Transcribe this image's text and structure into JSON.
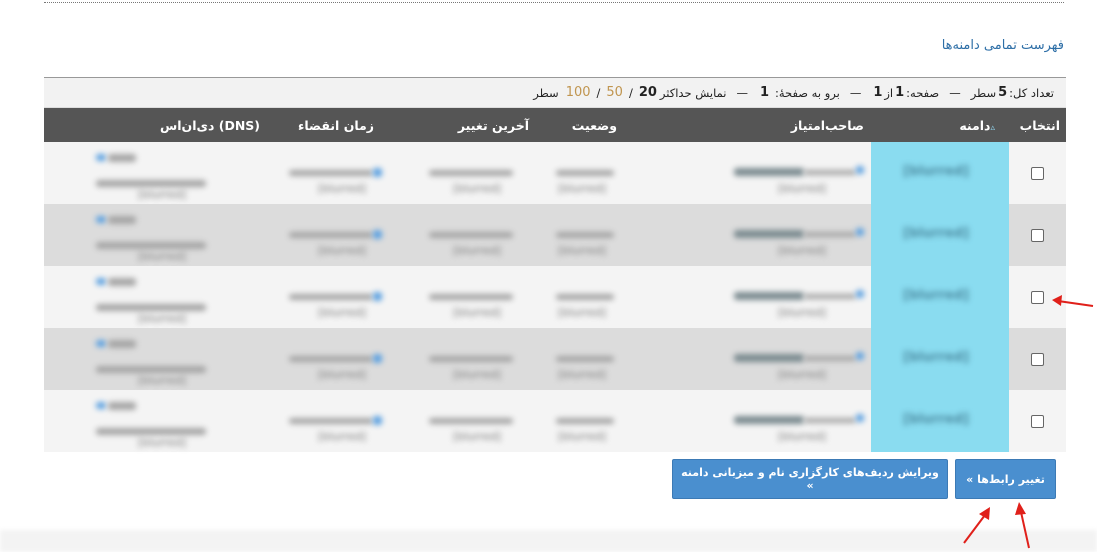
{
  "page_title": "فهرست تمامی دامنه‌ها",
  "info": {
    "total_label": "تعداد کل:",
    "total_value": "5",
    "rows_word": "سطر",
    "page_label": "صفحه:",
    "page_value": "1",
    "of_word": "از",
    "page_count": "1",
    "goto_label": "برو به صفحهٔ:",
    "goto_value": "1",
    "max_label": "نمایش حداکثر",
    "options": [
      "20",
      "50",
      "100"
    ],
    "rows_suffix": "سطر"
  },
  "columns": {
    "select": "انتخاب",
    "domain": "دامنه",
    "owner": "صاحب‌امتیاز",
    "status": "وضعیت",
    "last_change": "آخرین تغییر",
    "expiry": "زمان انقضاء",
    "dns": "دی‌ان‌اس (DNS)"
  },
  "icons": {
    "sort": "sort-ascending-icon",
    "arrow_color": "#e0201a"
  },
  "rows": [
    {
      "domain": "[blurred]",
      "owner": "[blurred]",
      "status": "[blurred]",
      "last_change": "[blurred]",
      "expiry": "[blurred]",
      "dns": "[blurred]"
    },
    {
      "domain": "[blurred]",
      "owner": "[blurred]",
      "status": "[blurred]",
      "last_change": "[blurred]",
      "expiry": "[blurred]",
      "dns": "[blurred]"
    },
    {
      "domain": "[blurred]",
      "owner": "[blurred]",
      "status": "[blurred]",
      "last_change": "[blurred]",
      "expiry": "[blurred]",
      "dns": "[blurred]"
    },
    {
      "domain": "[blurred]",
      "owner": "[blurred]",
      "status": "[blurred]",
      "last_change": "[blurred]",
      "expiry": "[blurred]",
      "dns": "[blurred]"
    },
    {
      "domain": "[blurred]",
      "owner": "[blurred]",
      "status": "[blurred]",
      "last_change": "[blurred]",
      "expiry": "[blurred]",
      "dns": "[blurred]"
    }
  ],
  "buttons": {
    "change_links": "تغییر رابط‌ها »",
    "edit_records": "ویرایش ردیف‌های کارگزاری نام و میزبانی دامنه »"
  },
  "colors": {
    "accent": "#4a8fcf",
    "header_bg": "#555555",
    "domain_highlight": "#8adcf0",
    "title": "#2e6fa7",
    "option_link": "#c0954f"
  }
}
